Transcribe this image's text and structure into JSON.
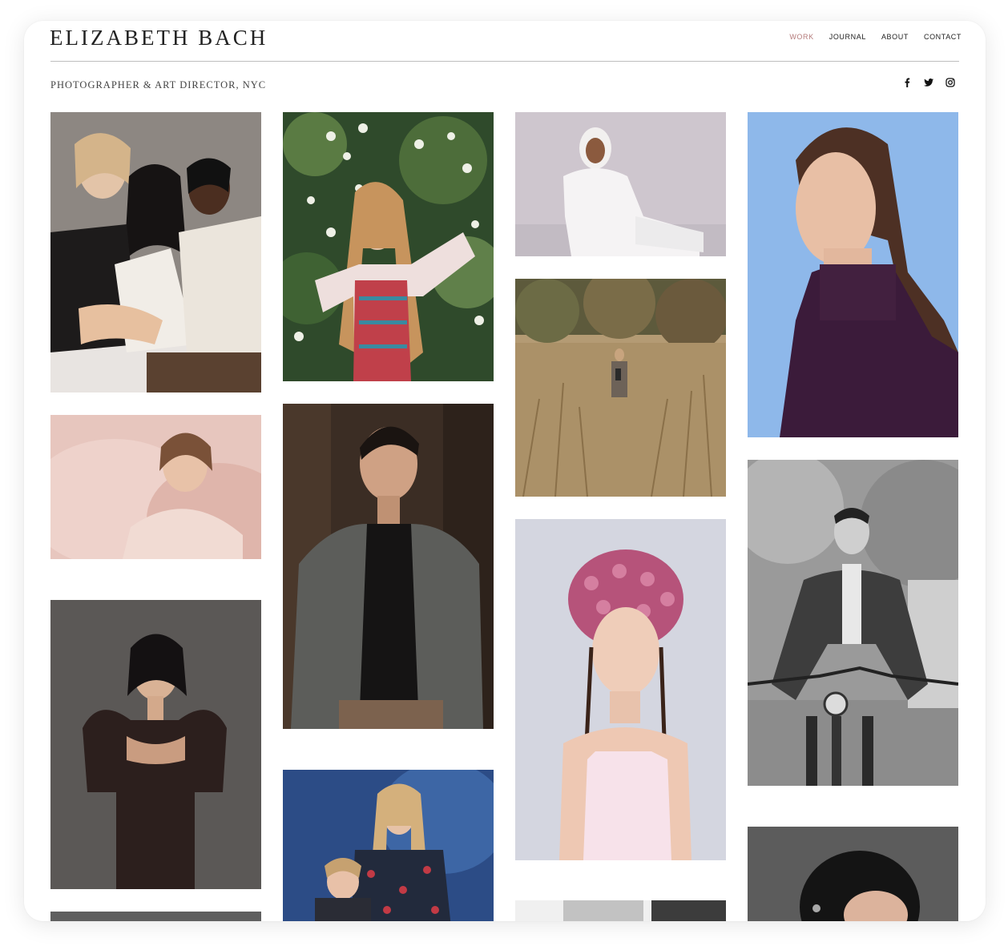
{
  "site": {
    "brand": "ELIZABETH BACH",
    "tagline": "PHOTOGRAPHER & ART DIRECTOR, NYC"
  },
  "nav": [
    {
      "label": "WORK",
      "active": true
    },
    {
      "label": "JOURNAL",
      "active": false
    },
    {
      "label": "ABOUT",
      "active": false
    },
    {
      "label": "CONTACT",
      "active": false
    }
  ],
  "social": [
    "facebook-icon",
    "twitter-icon",
    "instagram-icon"
  ],
  "colors": {
    "accent": "#b47a7a",
    "text": "#222222",
    "rule": "#bdbdbd"
  },
  "gallery": [
    {
      "name": "photo-three-models",
      "bg": "#8c8580"
    },
    {
      "name": "photo-pink-feathers",
      "bg": "#e6c3bb"
    },
    {
      "name": "photo-puff-sleeve-dress",
      "bg": "#5c5856"
    },
    {
      "name": "photo-blossom-tree",
      "bg": "#3d5a35"
    },
    {
      "name": "photo-man-plaid-blazer",
      "bg": "#3a2c24"
    },
    {
      "name": "photo-two-models-blue",
      "bg": "#2f4f86"
    },
    {
      "name": "photo-white-hijab",
      "bg": "#cfc8cf"
    },
    {
      "name": "photo-field-grass",
      "bg": "#a58d6b"
    },
    {
      "name": "photo-flower-headpiece",
      "bg": "#d3d6e0"
    },
    {
      "name": "photo-purple-turtleneck",
      "bg": "#8fb8ea"
    },
    {
      "name": "photo-bicycle-bw",
      "bg": "#7c7c7c"
    },
    {
      "name": "photo-profile-grey",
      "bg": "#5c5c5c"
    }
  ]
}
